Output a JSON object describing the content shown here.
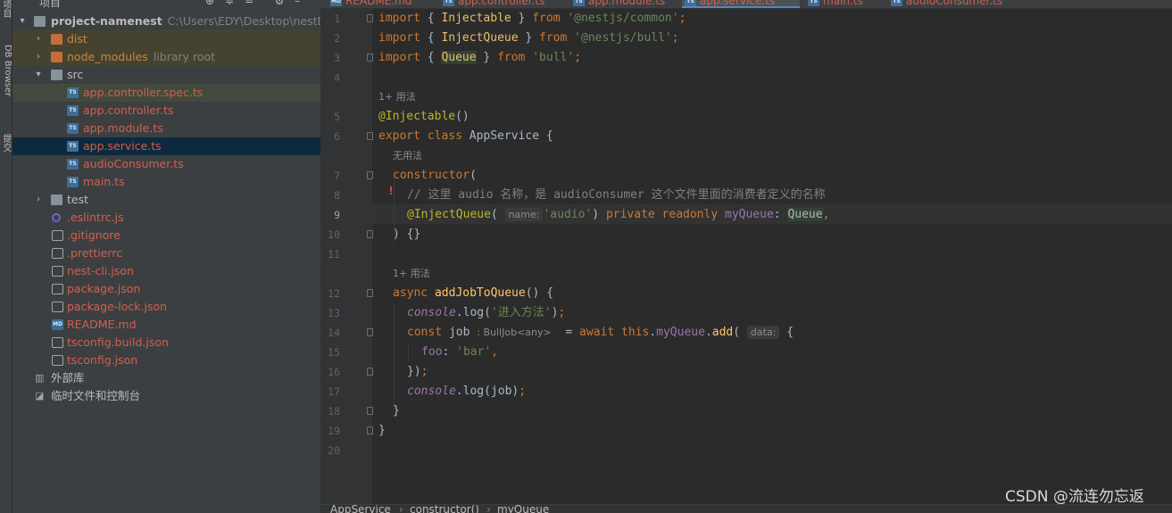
{
  "tool_strip": {
    "project_label": "项目",
    "db_browser_label": "DB Browser",
    "commit_label": "提交"
  },
  "project_panel": {
    "title": "项目",
    "root": {
      "name": "project-namenest",
      "path": "C:\\Users\\EDY\\Desktop\\nestDem"
    },
    "items": [
      {
        "label": "dist",
        "color": "orange",
        "icon": "folder-orange-icon"
      },
      {
        "label": "node_modules",
        "hint": "library root",
        "icon": "folder-orange-icon"
      },
      {
        "label": "src",
        "icon": "folder-icon"
      },
      {
        "label": "app.controller.spec.ts",
        "icon": "ts-file-icon"
      },
      {
        "label": "app.controller.ts",
        "icon": "ts-file-icon"
      },
      {
        "label": "app.module.ts",
        "icon": "ts-file-icon"
      },
      {
        "label": "app.service.ts",
        "icon": "ts-file-icon"
      },
      {
        "label": "audioConsumer.ts",
        "icon": "ts-file-icon"
      },
      {
        "label": "main.ts",
        "icon": "ts-file-icon"
      },
      {
        "label": "test",
        "icon": "folder-icon"
      },
      {
        "label": ".eslintrc.js",
        "icon": "eslint-icon"
      },
      {
        "label": ".gitignore",
        "icon": "config-file-icon"
      },
      {
        "label": ".prettierrc",
        "icon": "config-file-icon"
      },
      {
        "label": "nest-cli.json",
        "icon": "config-file-icon"
      },
      {
        "label": "package.json",
        "icon": "config-file-icon"
      },
      {
        "label": "package-lock.json",
        "icon": "config-file-icon"
      },
      {
        "label": "README.md",
        "icon": "markdown-icon"
      },
      {
        "label": "tsconfig.build.json",
        "icon": "config-file-icon"
      },
      {
        "label": "tsconfig.json",
        "icon": "config-file-icon"
      },
      {
        "label": "外部库",
        "icon": "library-icon"
      },
      {
        "label": "临时文件和控制台",
        "icon": "scratches-icon"
      }
    ]
  },
  "tabs": [
    {
      "label": "README.md"
    },
    {
      "label": "app.controller.ts"
    },
    {
      "label": "app.module.ts"
    },
    {
      "label": "app.service.ts"
    },
    {
      "label": "main.ts"
    },
    {
      "label": "audioConsumer.ts"
    }
  ],
  "editor": {
    "line_numbers": [
      "1",
      "2",
      "3",
      "4",
      "5",
      "6",
      "7",
      "8",
      "9",
      "10",
      "11",
      "12",
      "13",
      "14",
      "15",
      "16",
      "17",
      "18",
      "19",
      "20"
    ],
    "usages_1": "1+ 用法",
    "usages_none": "无用法",
    "usages_2": "1+ 用法",
    "comment": "// 这里 audio 名称，是 audioConsumer 这个文件里面的消费者定义的名称",
    "param_hint_name": "name:",
    "param_hint_data": "data:",
    "type_hint_job": ": BullJob<any>",
    "string_audio": "'audio'",
    "string_log": "'进入方法'",
    "string_bar": "'bar'",
    "import_1_module": "'@nestjs/common'",
    "import_2_module": "'@nestjs/bull'",
    "import_3_module": "'bull'"
  },
  "breadcrumb": [
    "AppService",
    "constructor()",
    "myQueue"
  ],
  "watermark": "CSDN @流连勿忘返"
}
